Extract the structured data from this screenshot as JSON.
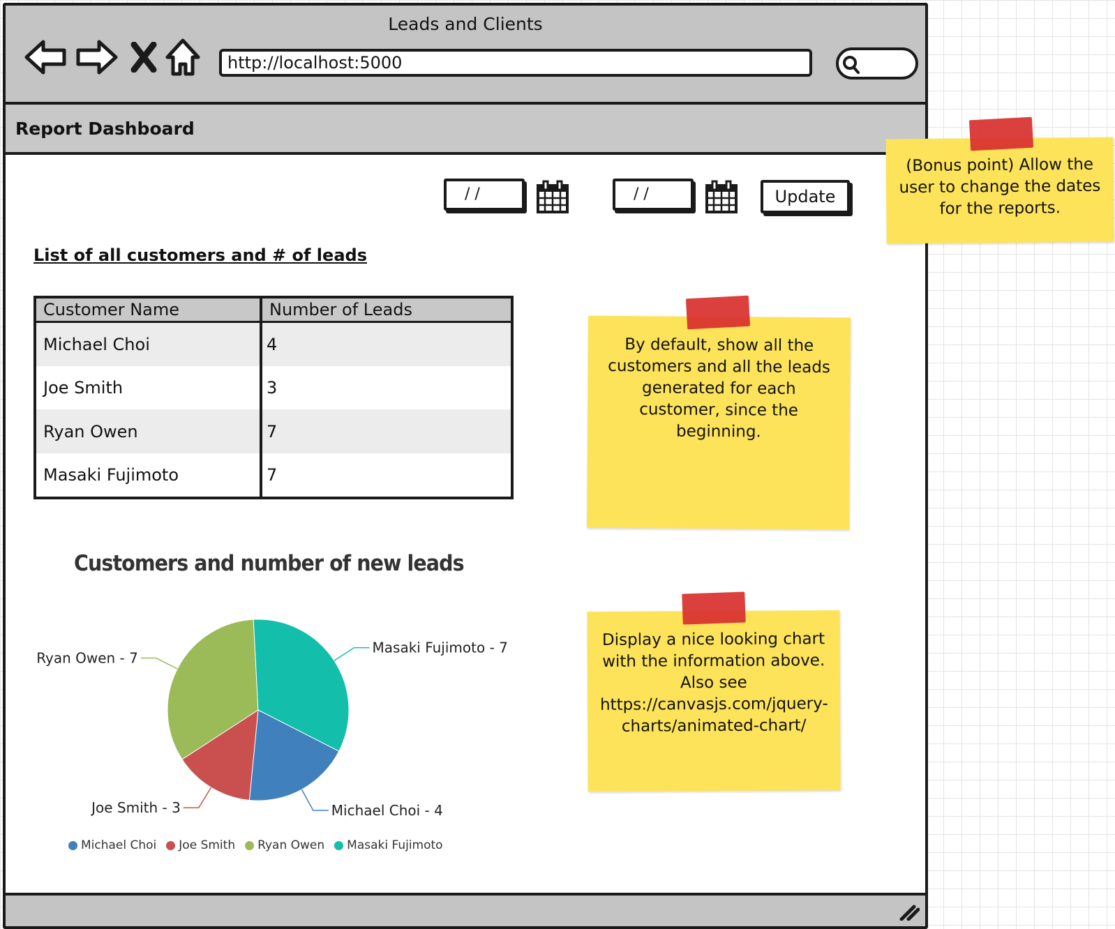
{
  "window": {
    "title": "Leads and Clients"
  },
  "browser": {
    "url": "http://localhost:5000",
    "icons": [
      "back-arrow-icon",
      "forward-arrow-icon",
      "close-icon",
      "home-icon",
      "search-icon"
    ]
  },
  "page": {
    "title": "Report Dashboard"
  },
  "filters": {
    "start_date": "/ /",
    "end_date": "/ /",
    "update_label": "Update"
  },
  "customers": {
    "heading": "List of all customers and # of leads",
    "columns": [
      "Customer Name",
      "Number of Leads"
    ],
    "rows": [
      {
        "name": "Michael Choi",
        "leads": "4"
      },
      {
        "name": "Joe Smith",
        "leads": "3"
      },
      {
        "name": "Ryan Owen",
        "leads": "7"
      },
      {
        "name": "Masaki Fujimoto",
        "leads": "7"
      }
    ]
  },
  "chart_data": {
    "type": "pie",
    "title": "Customers and number of new leads",
    "categories": [
      "Michael Choi",
      "Joe Smith",
      "Ryan Owen",
      "Masaki Fujimoto"
    ],
    "values": [
      4,
      3,
      7,
      7
    ],
    "colors": [
      "#4080bd",
      "#c9504f",
      "#9bbb59",
      "#13bfaa"
    ],
    "slice_labels": [
      "Michael Choi - 4",
      "Joe Smith - 3",
      "Ryan Owen - 7",
      "Masaki Fujimoto - 7"
    ],
    "legend_position": "bottom"
  },
  "notes": {
    "bonus": "(Bonus point) Allow the user to change the dates for the reports.",
    "default": "By default, show all the customers and all the leads generated for each customer, since the beginning.",
    "chart": "Display a nice looking chart with the information above.  Also see https://canvasjs.com/jquery-charts/animated-chart/"
  },
  "colors": {
    "sticky": "#fde35a",
    "tape": "#d8302e",
    "chrome": "#c4c4c4"
  }
}
